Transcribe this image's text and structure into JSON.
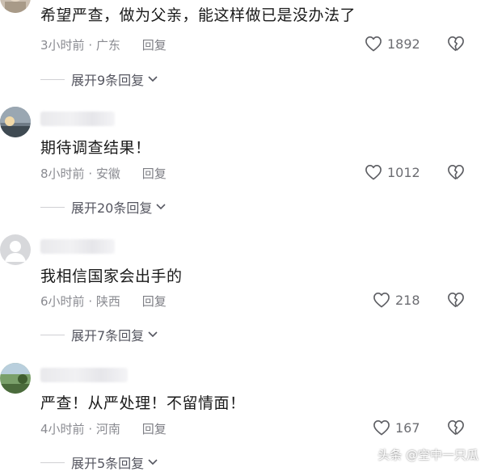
{
  "comments": [
    {
      "text": "希望严查，做为父亲，能这样做已是没办法了",
      "time": "3小时前",
      "location": "广东",
      "reply_label": "回复",
      "likes": "1892",
      "expand": "展开9条回复"
    },
    {
      "text": "期待调查结果！",
      "time": "8小时前",
      "location": "安徽",
      "reply_label": "回复",
      "likes": "1012",
      "expand": "展开20条回复"
    },
    {
      "text": "我相信国家会出手的",
      "time": "6小时前",
      "location": "陕西",
      "reply_label": "回复",
      "likes": "218",
      "expand": "展开7条回复"
    },
    {
      "text": "严查！从严处理！不留情面！",
      "time": "4小时前",
      "location": "河南",
      "reply_label": "回复",
      "likes": "167",
      "expand": "展开5条回复"
    }
  ],
  "separator": "·",
  "watermark": "头条 @空中一只瓜",
  "icons": {
    "like": "heart-outline-icon",
    "dislike": "broken-heart-icon",
    "expand": "chevron-down-icon"
  }
}
